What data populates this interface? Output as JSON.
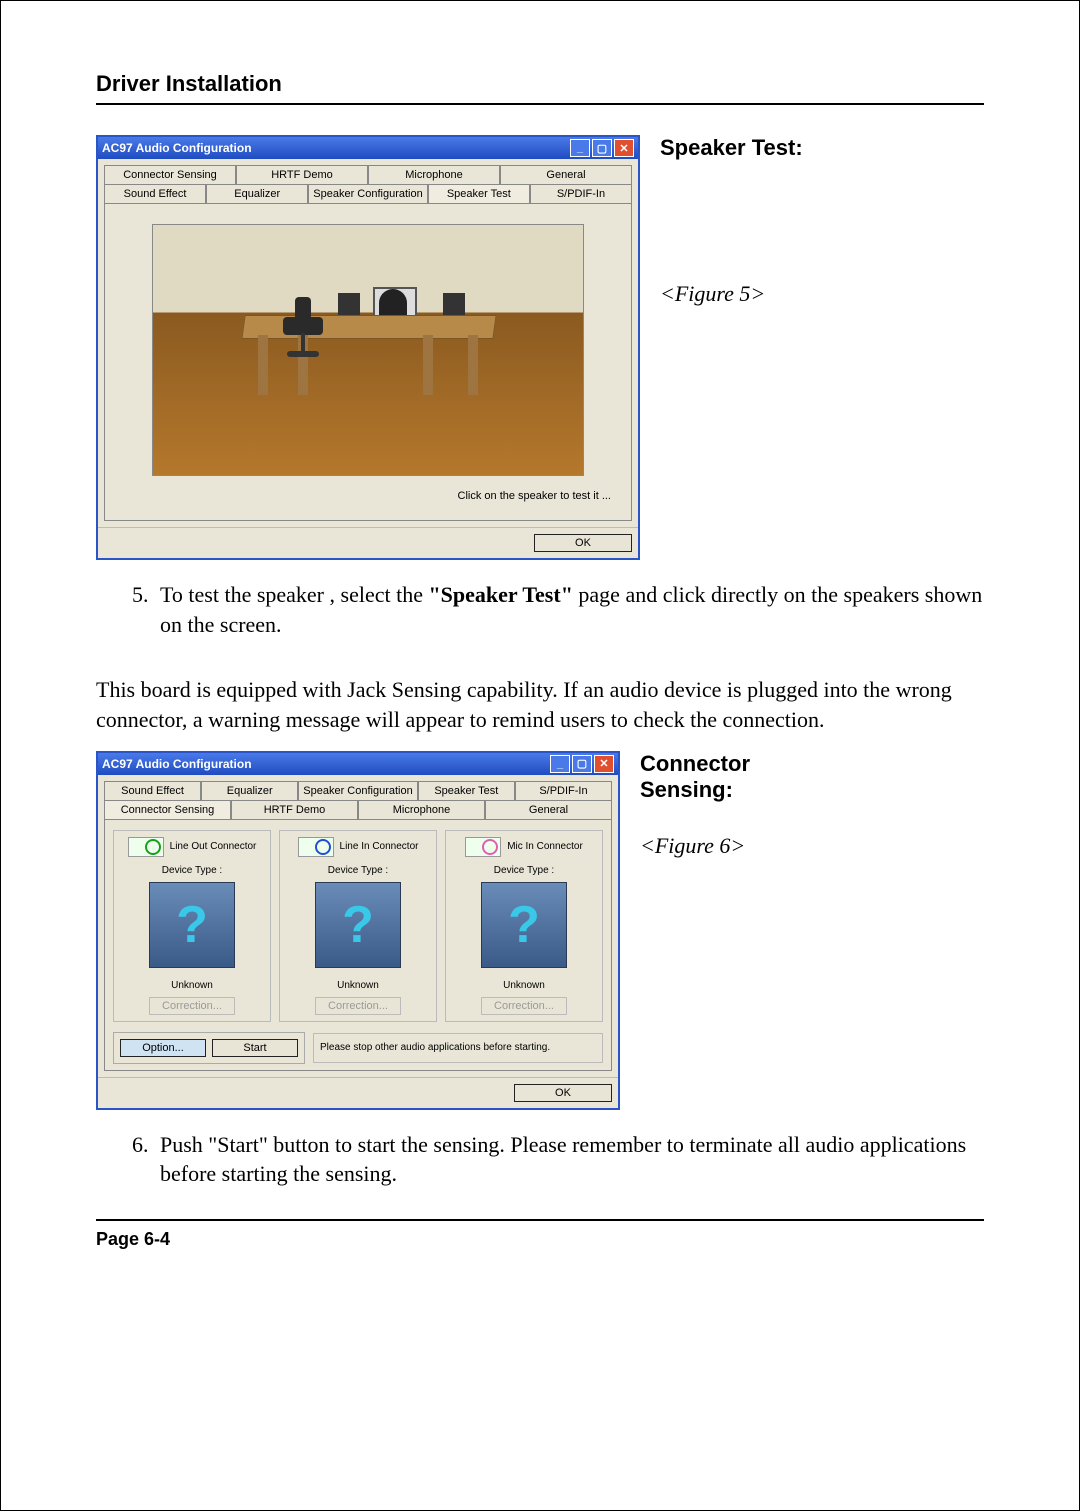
{
  "header": {
    "title": "Driver Installation"
  },
  "figure5": {
    "heading": "Speaker Test:",
    "caption": "<Figure 5>",
    "window_title": "AC97 Audio Configuration",
    "tabs_row1": [
      "Connector Sensing",
      "HRTF Demo",
      "Microphone",
      "General"
    ],
    "tabs_row2": [
      "Sound Effect",
      "Equalizer",
      "Speaker Configuration",
      "Speaker Test",
      "S/PDIF-In"
    ],
    "active_tab": "Speaker Test",
    "hint": "Click on the speaker to test it ...",
    "ok": "OK"
  },
  "step5": {
    "n": "5",
    "pre": "To test the speaker , select the ",
    "bold": "\"Speaker Test\"",
    "post": " page and click directly on the speakers shown on the screen."
  },
  "jack_para": "This board is equipped with Jack Sensing capability. If an audio device is plugged into the wrong connector, a warning message will appear to remind users to check the connection.",
  "figure6": {
    "heading": "Connector Sensing:",
    "caption": "<Figure 6>",
    "window_title": "AC97 Audio Configuration",
    "tabs_row1": [
      "Sound Effect",
      "Equalizer",
      "Speaker Configuration",
      "Speaker Test",
      "S/PDIF-In"
    ],
    "tabs_row2": [
      "Connector Sensing",
      "HRTF Demo",
      "Microphone",
      "General"
    ],
    "active_tab": "Connector Sensing",
    "cols": [
      {
        "label": "Line Out Connector",
        "ring": "green",
        "device": "Device Type :",
        "status": "Unknown",
        "btn": "Correction..."
      },
      {
        "label": "Line In Connector",
        "ring": "blue",
        "device": "Device Type :",
        "status": "Unknown",
        "btn": "Correction..."
      },
      {
        "label": "Mic In Connector",
        "ring": "pink",
        "device": "Device Type :",
        "status": "Unknown",
        "btn": "Correction..."
      }
    ],
    "option": "Option...",
    "start": "Start",
    "msg": "Please stop other audio applications before starting.",
    "ok": "OK"
  },
  "step6": {
    "n": "6",
    "text": "Push \"Start\" button to start the sensing. Please remember to terminate all audio applications before starting the sensing."
  },
  "footer": {
    "page": "Page 6-4"
  }
}
